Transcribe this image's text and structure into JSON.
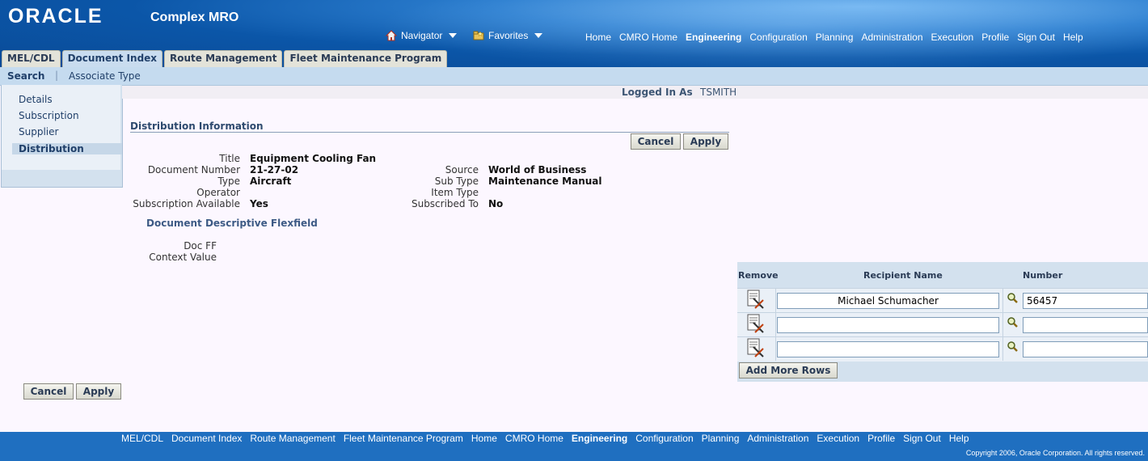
{
  "header": {
    "logo_text": "ORACLE",
    "app_name": "Complex MRO",
    "navigator_label": "Navigator",
    "favorites_label": "Favorites",
    "global_links": [
      "Home",
      "CMRO Home",
      "Engineering",
      "Configuration",
      "Planning",
      "Administration",
      "Execution",
      "Profile",
      "Sign Out",
      "Help"
    ],
    "active_global_link": "Engineering"
  },
  "tabs": {
    "items": [
      "MEL/CDL",
      "Document Index",
      "Route Management",
      "Fleet Maintenance Program"
    ],
    "selected": "Document Index"
  },
  "subtabs": {
    "search": "Search",
    "associate_type": "Associate Type"
  },
  "sidenav": {
    "items": [
      "Details",
      "Subscription",
      "Supplier",
      "Distribution"
    ],
    "selected": "Distribution"
  },
  "session": {
    "logged_in_label": "Logged In As",
    "user": "TSMITH"
  },
  "section": {
    "title": "Distribution Information",
    "cancel_label": "Cancel",
    "apply_label": "Apply"
  },
  "fields": {
    "title_label": "Title",
    "title_value": "Equipment Cooling Fan",
    "doc_number_label": "Document Number",
    "doc_number_value": "21-27-02",
    "type_label": "Type",
    "type_value": "Aircraft",
    "operator_label": "Operator",
    "operator_value": "",
    "sub_available_label": "Subscription Available",
    "sub_available_value": "Yes",
    "source_label": "Source",
    "source_value": "World of Business",
    "subtype_label": "Sub Type",
    "subtype_value": "Maintenance Manual",
    "itemtype_label": "Item Type",
    "itemtype_value": "",
    "subscribed_to_label": "Subscribed To",
    "subscribed_to_value": "No"
  },
  "flexfield": {
    "title": "Document Descriptive Flexfield",
    "doc_ff_label": "Doc FF",
    "context_label": "Context Value"
  },
  "recipients": {
    "headers": {
      "remove": "Remove",
      "name": "Recipient Name",
      "number": "Number"
    },
    "rows": [
      {
        "name": "Michael Schumacher",
        "number": "56457"
      },
      {
        "name": "",
        "number": ""
      },
      {
        "name": "",
        "number": ""
      }
    ],
    "add_rows_label": "Add More Rows"
  },
  "bottom_buttons": {
    "cancel_label": "Cancel",
    "apply_label": "Apply"
  },
  "footer": {
    "links": [
      "MEL/CDL",
      "Document Index",
      "Route Management",
      "Fleet Maintenance Program",
      "Home",
      "CMRO Home",
      "Engineering",
      "Configuration",
      "Planning",
      "Administration",
      "Execution",
      "Profile",
      "Sign Out",
      "Help"
    ],
    "active_link": "Engineering",
    "copyright": "Copyright 2006, Oracle Corporation. All rights reserved."
  }
}
